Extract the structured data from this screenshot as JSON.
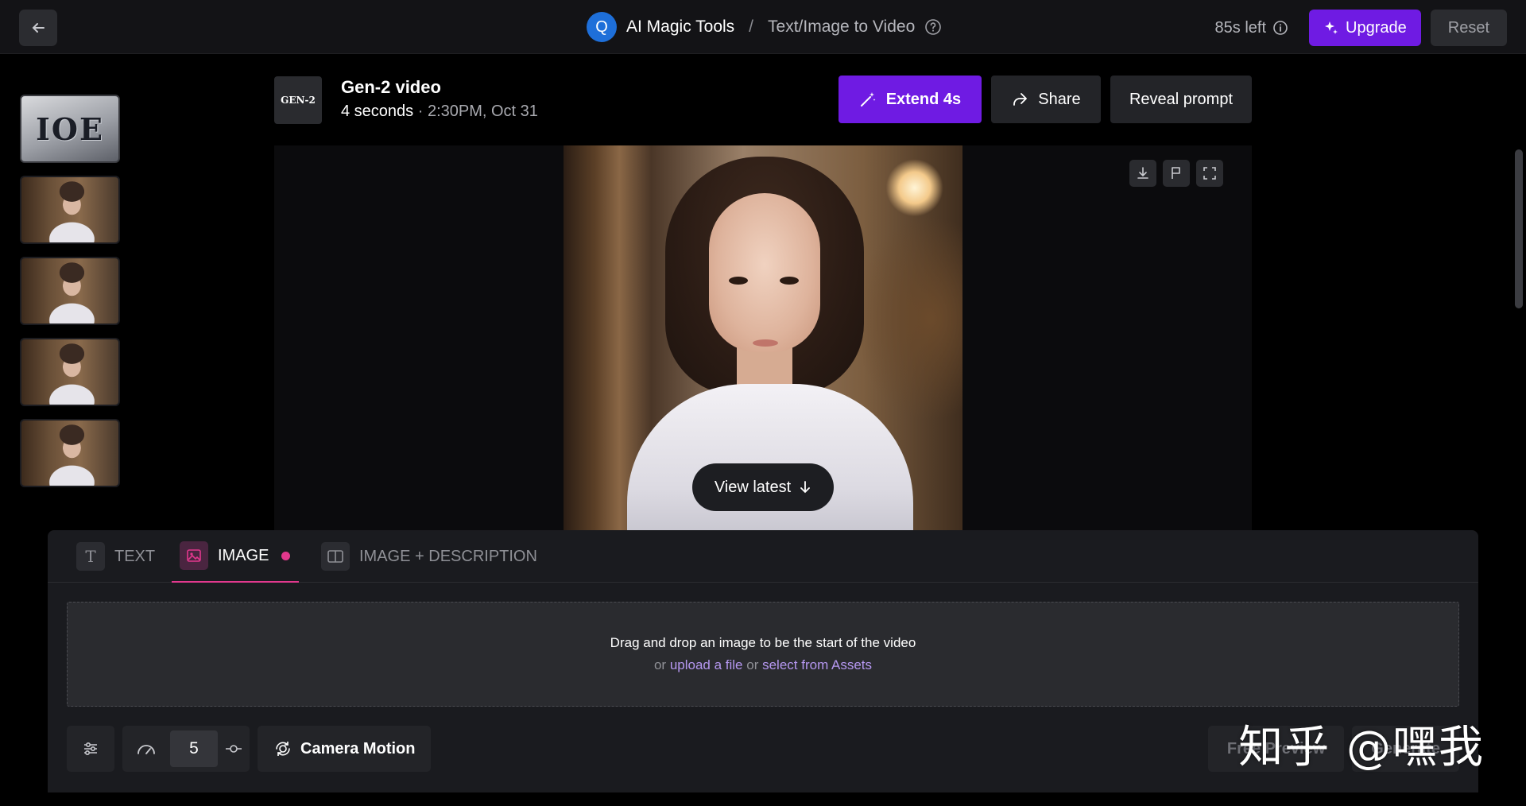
{
  "topbar": {
    "avatar_letter": "Q",
    "tool_name": "AI Magic Tools",
    "separator": "/",
    "current_page": "Text/Image to Video",
    "credits": "85s left",
    "upgrade_label": "Upgrade",
    "reset_label": "Reset"
  },
  "media": {
    "model_logo": "GEN-2",
    "title": "Gen-2 video",
    "duration": "4 seconds",
    "timestamp": "· 2:30PM, Oct 31",
    "extend_label": "Extend 4s",
    "share_label": "Share",
    "reveal_label": "Reveal prompt",
    "view_latest_label": "View latest"
  },
  "thumbnails": [
    {
      "type": "text-image",
      "text": "IOE"
    },
    {
      "type": "portrait"
    },
    {
      "type": "portrait"
    },
    {
      "type": "portrait"
    },
    {
      "type": "portrait"
    }
  ],
  "tabs": [
    {
      "label": "TEXT",
      "icon": "T"
    },
    {
      "label": "IMAGE",
      "icon": "image-icon"
    },
    {
      "label": "IMAGE + DESCRIPTION",
      "icon": "split-panel-icon"
    }
  ],
  "dropzone": {
    "main_text": "Drag and drop an image to be the start of the video",
    "or1": "or",
    "upload_link": "upload a file",
    "or2": "or",
    "assets_link": "select from Assets"
  },
  "controls": {
    "speed_value": "5",
    "camera_label": "Camera Motion",
    "free_preview_label": "Free Preview",
    "generate_label": "Generate"
  },
  "watermark": "知乎 @嘿我",
  "colors": {
    "accent_purple": "#6f1be3",
    "accent_pink": "#e2388d",
    "link_purple": "#b597f0"
  }
}
